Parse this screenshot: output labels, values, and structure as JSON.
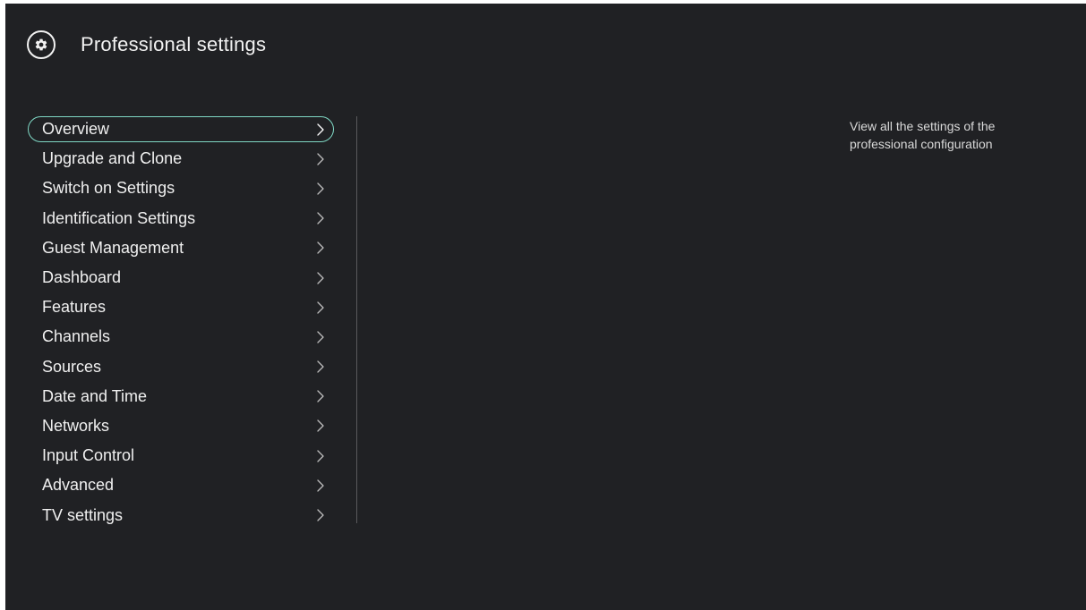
{
  "header": {
    "title": "Professional settings",
    "icon": "gear-icon"
  },
  "menu": {
    "selected_index": 0,
    "items": [
      {
        "label": "Overview"
      },
      {
        "label": "Upgrade and Clone"
      },
      {
        "label": "Switch on Settings"
      },
      {
        "label": "Identification Settings"
      },
      {
        "label": "Guest Management"
      },
      {
        "label": "Dashboard"
      },
      {
        "label": "Features"
      },
      {
        "label": "Channels"
      },
      {
        "label": "Sources"
      },
      {
        "label": "Date and Time"
      },
      {
        "label": "Networks"
      },
      {
        "label": "Input Control"
      },
      {
        "label": "Advanced"
      },
      {
        "label": "TV settings"
      }
    ]
  },
  "description": {
    "text": "View all the settings of the professional configuration"
  },
  "colors": {
    "background": "#202124",
    "text": "#f0f0f0",
    "focus_outline": "#7fd7c4",
    "divider": "#5a5a5c"
  }
}
